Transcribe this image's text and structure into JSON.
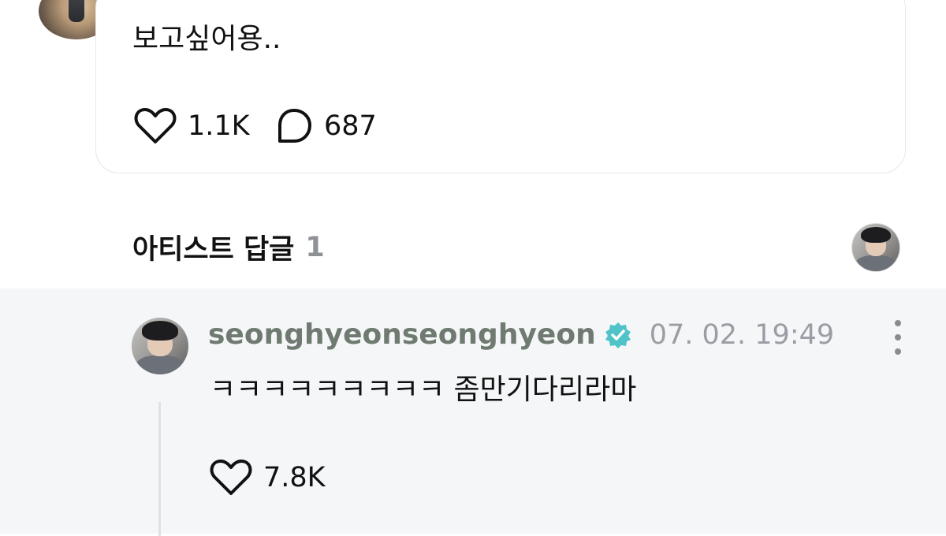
{
  "post": {
    "text": "보고싶어용..",
    "likes": "1.1K",
    "comments": "687"
  },
  "section": {
    "title": "아티스트 답글",
    "count": "1"
  },
  "reply": {
    "username": "seonghyeonseonghyeon",
    "timestamp": "07. 02. 19:49",
    "text": "ㅋㅋㅋㅋㅋㅋㅋㅋㅋ 좀만기다리라마",
    "likes": "7.8K"
  },
  "colors": {
    "verified": "#4fc3c7",
    "username": "#6f7a70",
    "reply_bg": "#f5f6f8"
  }
}
